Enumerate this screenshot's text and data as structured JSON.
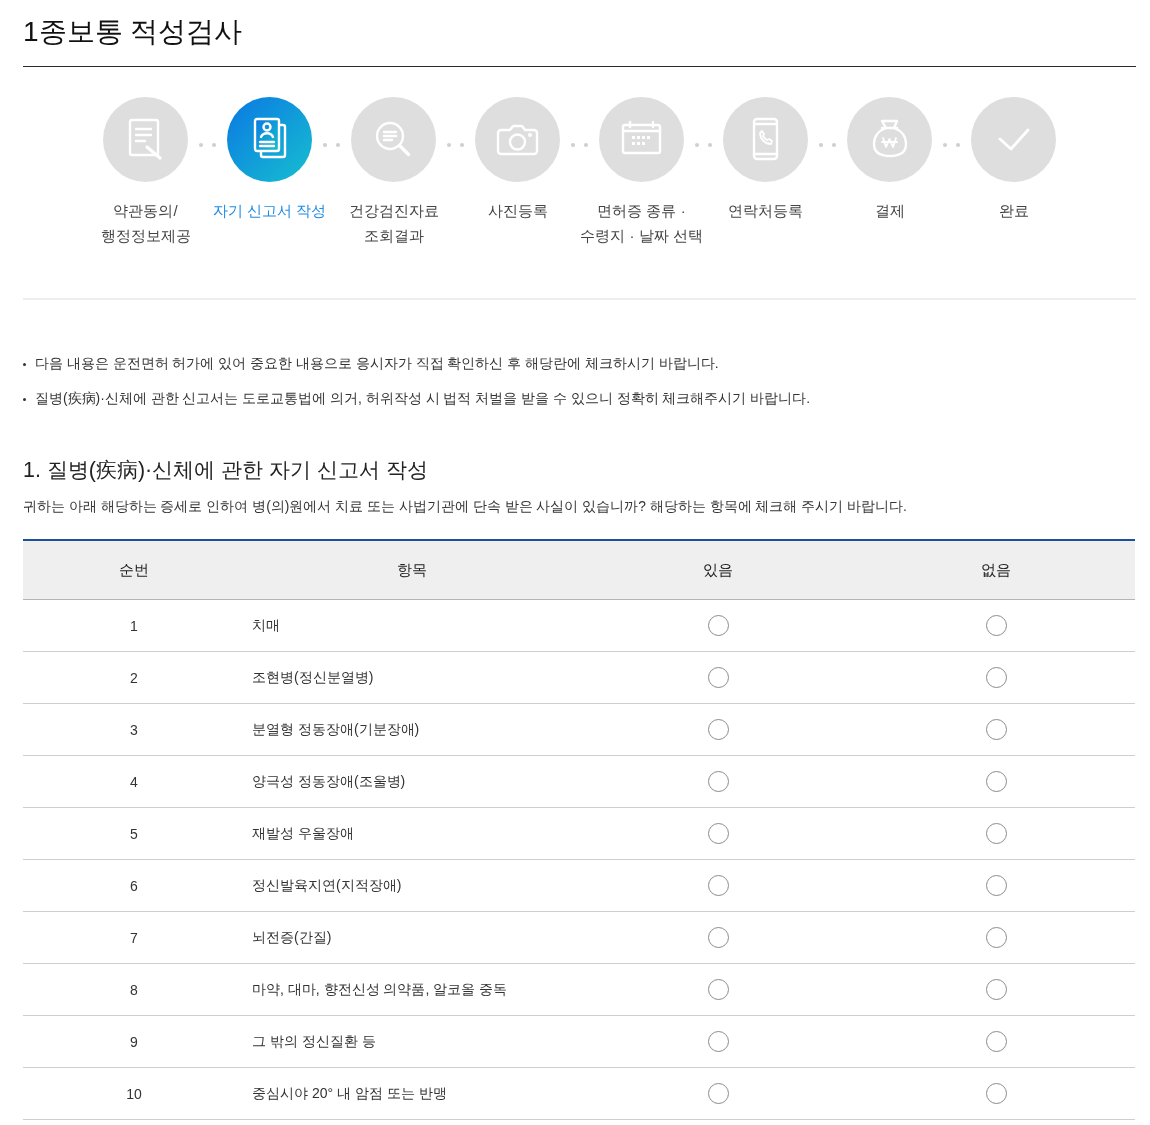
{
  "page": {
    "title": "1종보통 적성검사"
  },
  "steps": [
    {
      "label": "약관동의/\n행정정보제공",
      "selected": false
    },
    {
      "label": "자기 신고서 작성",
      "selected": true
    },
    {
      "label": "건강검진자료\n조회결과",
      "selected": false
    },
    {
      "label": "사진등록",
      "selected": false
    },
    {
      "label": "면허증 종류 ·\n수령지 · 날짜 선택",
      "selected": false
    },
    {
      "label": "연락처등록",
      "selected": false
    },
    {
      "label": "결제",
      "selected": false
    },
    {
      "label": "완료",
      "selected": false
    }
  ],
  "notes": [
    "다음 내용은 운전면허 허가에 있어 중요한 내용으로 응시자가 직접 확인하신 후 해당란에 체크하시기 바랍니다.",
    "질병(疾病)·신체에 관한 신고서는 도로교통법에 의거, 허위작성 시 법적 처벌을 받을 수 있으니 정확히 체크해주시기 바랍니다."
  ],
  "section": {
    "heading": "1. 질병(疾病)·신체에 관한 자기 신고서 작성",
    "description": "귀하는 아래 해당하는 증세로 인하여 병(의)원에서 치료 또는 사법기관에 단속 받은 사실이 있습니까? 해당하는 항목에 체크해 주시기 바랍니다."
  },
  "table": {
    "columns": [
      "순번",
      "항목",
      "있음",
      "없음"
    ],
    "rows": [
      {
        "number": "1",
        "item": "치매",
        "choices": [
          {
            "selected": false
          },
          {
            "selected": false
          }
        ]
      },
      {
        "number": "2",
        "item": "조현병(정신분열병)",
        "choices": [
          {
            "selected": false
          },
          {
            "selected": false
          }
        ]
      },
      {
        "number": "3",
        "item": "분열형 정동장애(기분장애)",
        "choices": [
          {
            "selected": false
          },
          {
            "selected": false
          }
        ]
      },
      {
        "number": "4",
        "item": "양극성 정동장애(조울병)",
        "choices": [
          {
            "selected": false
          },
          {
            "selected": false
          }
        ]
      },
      {
        "number": "5",
        "item": "재발성 우울장애",
        "choices": [
          {
            "selected": false
          },
          {
            "selected": false
          }
        ]
      },
      {
        "number": "6",
        "item": "정신발육지연(지적장애)",
        "choices": [
          {
            "selected": false
          },
          {
            "selected": false
          }
        ]
      },
      {
        "number": "7",
        "item": "뇌전증(간질)",
        "choices": [
          {
            "selected": false
          },
          {
            "selected": false
          }
        ]
      },
      {
        "number": "8",
        "item": "마약, 대마, 향전신성 의약품, 알코올 중독",
        "choices": [
          {
            "selected": false
          },
          {
            "selected": false
          }
        ]
      },
      {
        "number": "9",
        "item": "그 밖의 정신질환 등",
        "choices": [
          {
            "selected": false
          },
          {
            "selected": false
          }
        ]
      },
      {
        "number": "10",
        "item": "중심시야 20° 내 암점 또는 반맹",
        "choices": [
          {
            "selected": false
          },
          {
            "selected": false
          }
        ]
      }
    ]
  }
}
